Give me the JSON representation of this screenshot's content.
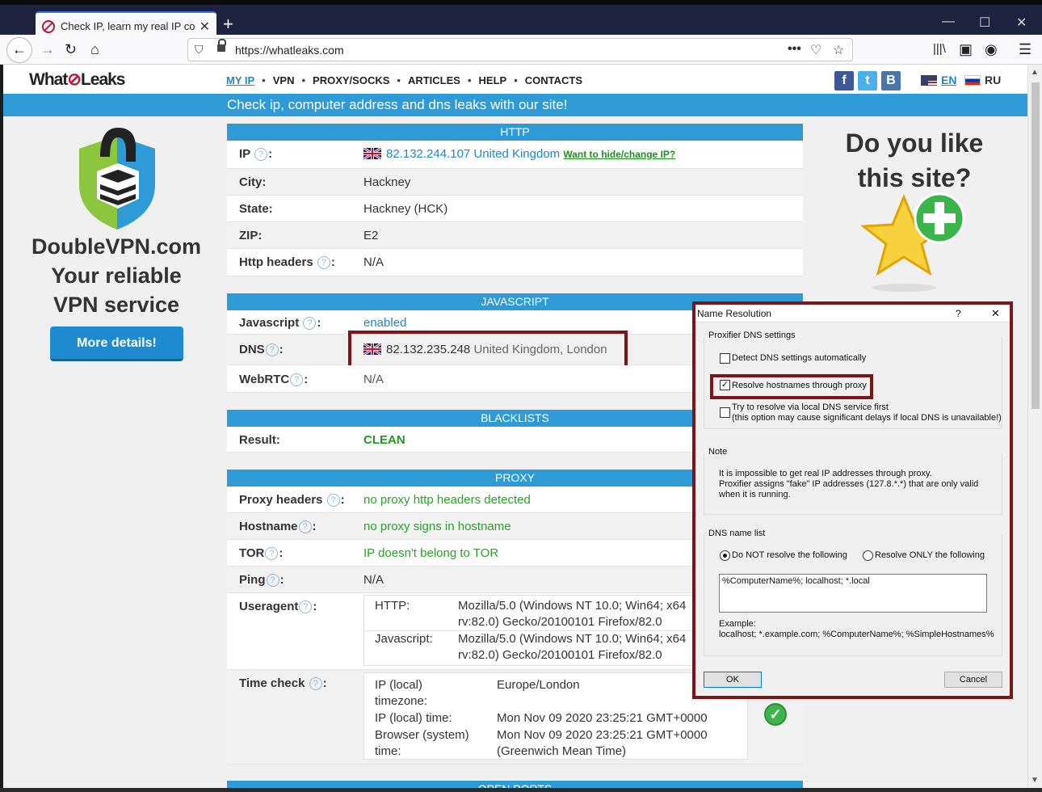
{
  "browser": {
    "tab_title": "Check IP, learn my real IP comp",
    "tab_close": "✕",
    "new_tab": "+",
    "url": "https://whatleaks.com",
    "win_min": "—",
    "win_max": "☐",
    "win_close": "✕"
  },
  "site": {
    "logo_pre": "What",
    "logo_post": "Leaks",
    "menu": [
      "MY IP",
      "VPN",
      "PROXY/SOCKS",
      "ARTICLES",
      "HELP",
      "CONTACTS"
    ],
    "social": [
      "f",
      "t",
      "B"
    ],
    "lang_en": "EN",
    "lang_ru": "RU",
    "banner": "Check ip, computer address and dns leaks with our site!"
  },
  "left_ad": {
    "line1": "DoubleVPN.com",
    "line2": "Your reliable",
    "line3": "VPN service",
    "button": "More details!"
  },
  "right_ad": {
    "line1": "Do you like",
    "line2": "this site?"
  },
  "http": {
    "header": "HTTP",
    "ip_label": "IP",
    "ip_value": "82.132.244.107 United Kingdom",
    "ip_link": "Want to hide/change IP?",
    "city_label": "City:",
    "city_value": "Hackney",
    "state_label": "State:",
    "state_value": "Hackney (HCK)",
    "zip_label": "ZIP:",
    "zip_value": "E2",
    "headers_label": "Http headers",
    "headers_value": "N/A"
  },
  "javascript": {
    "header": "JAVASCRIPT",
    "js_label": "Javascript",
    "js_value": "enabled",
    "dns_label": "DNS",
    "dns_ip": "82.132.235.248",
    "dns_loc": "United Kingdom, London",
    "webrtc_label": "WebRTC",
    "webrtc_value": "N/A"
  },
  "blacklists": {
    "header": "BLACKLISTS",
    "result_label": "Result:",
    "result_value": "CLEAN"
  },
  "proxy": {
    "header": "PROXY",
    "proxy_headers_label": "Proxy headers",
    "proxy_headers_value": "no proxy http headers detected",
    "hostname_label": "Hostname",
    "hostname_value": "no proxy signs in hostname",
    "tor_label": "TOR",
    "tor_value": "IP doesn't belong to TOR",
    "ping_label": "Ping",
    "ping_value": "N/A",
    "ua_label": "Useragent",
    "ua_http_key": "HTTP:",
    "ua_http_val1": "Mozilla/5.0 (Windows NT 10.0; Win64; x64",
    "ua_http_val2": "rv:82.0) Gecko/20100101 Firefox/82.0",
    "ua_js_key": "Javascript:",
    "ua_js_val1": "Mozilla/5.0 (Windows NT 10.0; Win64; x64",
    "ua_js_val2": "rv:82.0) Gecko/20100101 Firefox/82.0",
    "time_label": "Time check",
    "tz_key1": "IP (local)",
    "tz_key2": "timezone:",
    "tz_val": "Europe/London",
    "iptime_key": "IP (local) time:",
    "iptime_val": "Mon Nov 09 2020 23:25:21 GMT+0000",
    "btime_key1": "Browser (system)",
    "btime_key2": "time:",
    "btime_val1": "Mon Nov 09 2020 23:25:21 GMT+0000",
    "btime_val2": "(Greenwich Mean Time)",
    "next_header": "OPEN PORTS"
  },
  "dialog": {
    "title": "Name Resolution",
    "help": "?",
    "close": "✕",
    "group1": "Proxifier DNS settings",
    "cb1": "Detect DNS settings automatically",
    "cb2": "Resolve hostnames through proxy",
    "cb3_line1": "Try to resolve via local DNS service first",
    "cb3_line2": "(this option may cause significant delays if local DNS is unavailable!)",
    "group2": "Note",
    "note1": "It is impossible to get real IP addresses through proxy.",
    "note2": "Proxifier assigns \"fake\" IP addresses (127.8.*.*) that are only valid",
    "note3": "when it is running.",
    "group3": "DNS name list",
    "radio1": "Do NOT resolve the following",
    "radio2": "Resolve ONLY the following",
    "dns_list": "%ComputerName%; localhost; *.local",
    "example_label": "Example:",
    "example_value": "localhost; *.example.com; %ComputerName%; %SimpleHostnames%",
    "ok": "OK",
    "cancel": "Cancel"
  },
  "colors": {
    "accent_blue": "#2e9bd6",
    "highlight_red": "#7c1515",
    "ok_green": "#1f9a1f"
  }
}
